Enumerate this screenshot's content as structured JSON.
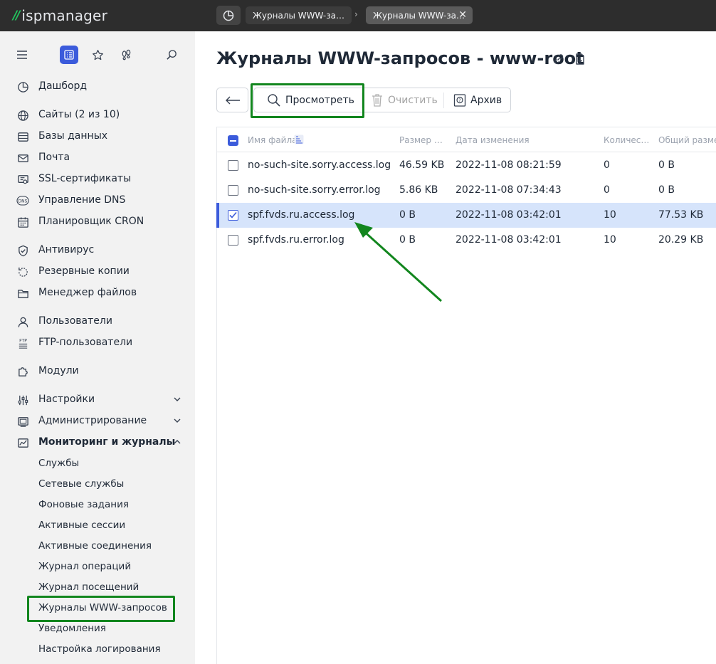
{
  "app": {
    "logo_text": "ispmanager"
  },
  "tabs": [
    {
      "label": "Журналы WWW-за…"
    },
    {
      "label": "Журналы WWW-за…"
    }
  ],
  "sidebar": {
    "tools": [
      "menu-icon",
      "list-icon",
      "star-icon",
      "footprints-icon",
      "search-icon"
    ],
    "items": [
      {
        "label": "Дашборд",
        "icon": "dashboard-icon"
      },
      {
        "label": "Сайты (2 из 10)",
        "icon": "globe-icon"
      },
      {
        "label": "Базы данных",
        "icon": "database-icon"
      },
      {
        "label": "Почта",
        "icon": "mail-icon"
      },
      {
        "label": "SSL-сертификаты",
        "icon": "certificate-icon"
      },
      {
        "label": "Управление DNS",
        "icon": "dns-icon"
      },
      {
        "label": "Планировщик CRON",
        "icon": "calendar-icon"
      },
      {
        "label": "Антивирус",
        "icon": "shield-icon"
      },
      {
        "label": "Резервные копии",
        "icon": "backup-icon"
      },
      {
        "label": "Менеджер файлов",
        "icon": "folder-icon"
      },
      {
        "label": "Пользователи",
        "icon": "user-icon"
      },
      {
        "label": "FTP-пользователи",
        "icon": "ftp-icon"
      },
      {
        "label": "Модули",
        "icon": "puzzle-icon"
      },
      {
        "label": "Настройки",
        "icon": "sliders-icon"
      },
      {
        "label": "Администрирование",
        "icon": "server-icon"
      },
      {
        "label": "Мониторинг и журналы",
        "icon": "monitoring-icon"
      }
    ],
    "subitems": [
      "Службы",
      "Сетевые службы",
      "Фоновые задания",
      "Активные сессии",
      "Активные соединения",
      "Журнал операций",
      "Журнал посещений",
      "Журналы WWW-запросов",
      "Уведомления",
      "Настройка логирования"
    ]
  },
  "main": {
    "title": "Журналы WWW-запросов - www-root",
    "toolbar": {
      "view": "Просмотреть",
      "clear": "Очистить",
      "archive": "Архив"
    },
    "columns": [
      "Имя файла",
      "Размер …",
      "Дата изменения",
      "Количес…",
      "Общий размер"
    ],
    "rows": [
      {
        "name": "no-such-site.sorry.access.log",
        "size": "46.59 KB",
        "date": "2022-11-08 08:21:59",
        "count": "0",
        "total": "0 B",
        "selected": false
      },
      {
        "name": "no-such-site.sorry.error.log",
        "size": "5.86 KB",
        "date": "2022-11-08 07:34:43",
        "count": "0",
        "total": "0 B",
        "selected": false
      },
      {
        "name": "spf.fvds.ru.access.log",
        "size": "0 B",
        "date": "2022-11-08 03:42:01",
        "count": "10",
        "total": "77.53 KB",
        "selected": true
      },
      {
        "name": "spf.fvds.ru.error.log",
        "size": "0 B",
        "date": "2022-11-08 03:42:01",
        "count": "10",
        "total": "20.29 KB",
        "selected": false
      }
    ]
  },
  "colors": {
    "accent": "#3b5bdb",
    "highlight_green": "#12861e",
    "selected_row": "#d6e4fb"
  }
}
